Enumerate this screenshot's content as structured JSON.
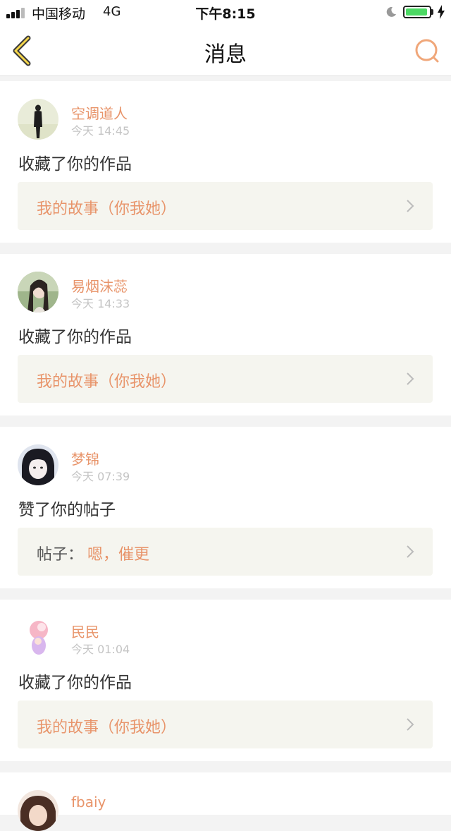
{
  "status_bar": {
    "carrier": "中国移动",
    "network": "4G",
    "time": "下午8:15",
    "battery_color": "#4cd964"
  },
  "nav": {
    "title": "消息",
    "back_icon": "chevron-left-icon",
    "search_icon": "search-icon"
  },
  "accent_color": "#e8946a",
  "notifications": [
    {
      "username": "空调道人",
      "time": "今天 14:45",
      "action": "收藏了你的作品",
      "link_prefix": "",
      "link_text": "我的故事（你我她）"
    },
    {
      "username": "易烟沫蕊",
      "time": "今天 14:33",
      "action": "收藏了你的作品",
      "link_prefix": "",
      "link_text": "我的故事（你我她）"
    },
    {
      "username": "梦锦",
      "time": "今天 07:39",
      "action": "赞了你的帖子",
      "link_prefix": "帖子：",
      "link_text": "嗯，催更"
    },
    {
      "username": "民民",
      "time": "今天 01:04",
      "action": "收藏了你的作品",
      "link_prefix": "",
      "link_text": "我的故事（你我她）"
    },
    {
      "username": "fbaiy"
    }
  ]
}
